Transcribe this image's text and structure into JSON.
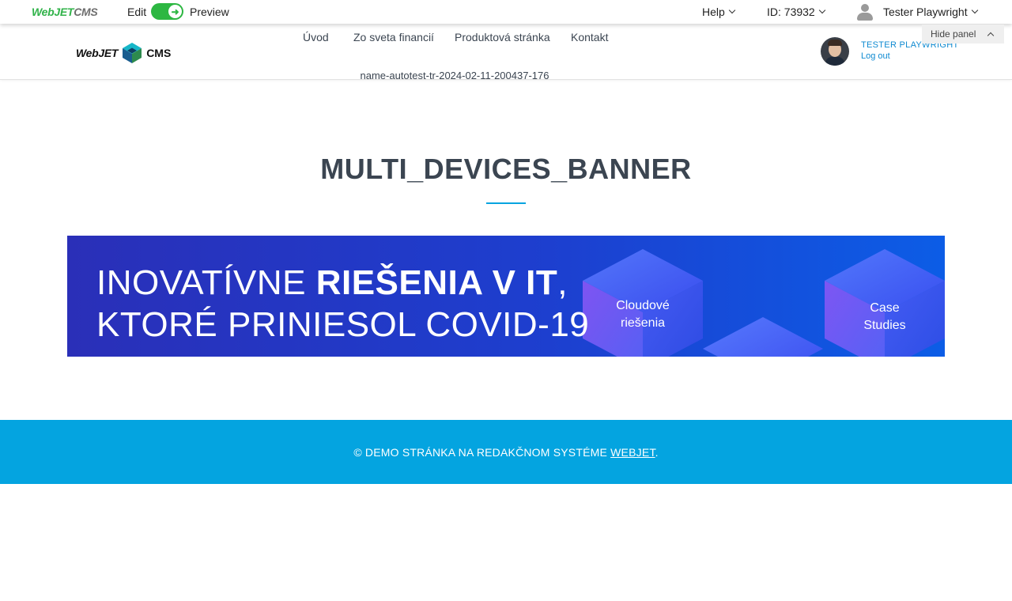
{
  "admin_bar": {
    "logo": {
      "part1": "Web",
      "part2": "JET",
      "part3": "CMS"
    },
    "edit_label": "Edit",
    "preview_label": "Preview",
    "help_label": "Help",
    "id_label": "ID: 73932",
    "user_label": "Tester Playwright",
    "colors": {
      "toggle": "#2db742"
    }
  },
  "header": {
    "logo": {
      "left": "WebJET",
      "right": "CMS"
    },
    "nav": [
      {
        "label": "Úvod"
      },
      {
        "label": "Zo sveta financií"
      },
      {
        "label": "Produktová stránka"
      },
      {
        "label": "Kontakt"
      }
    ],
    "nav_sub": "name-autotest-tr-2024-02-11-200437-176",
    "user": {
      "name": "TESTER PLAYWRIGHT",
      "logout": "Log out"
    },
    "hide_panel": "Hide panel"
  },
  "main": {
    "title": "MULTI_DEVICES_BANNER",
    "banner": {
      "line1_normal": "INOVATÍVNE ",
      "line1_bold": "RIEŠENIA V IT",
      "line1_tail": ",",
      "line2": "KTORÉ PRINIESOL COVID-19",
      "card1_line1": "Cloudové",
      "card1_line2": "riešenia",
      "card2_line1": "Case",
      "card2_line2": "Studies"
    }
  },
  "footer": {
    "text": "© DEMO STRÁNKA NA REDAKČNOM SYSTÉME ",
    "link": "WEBJET",
    "tail": "."
  },
  "colors": {
    "accent": "#04a4e0",
    "text": "#3b4551",
    "link": "#0f8ad1"
  }
}
